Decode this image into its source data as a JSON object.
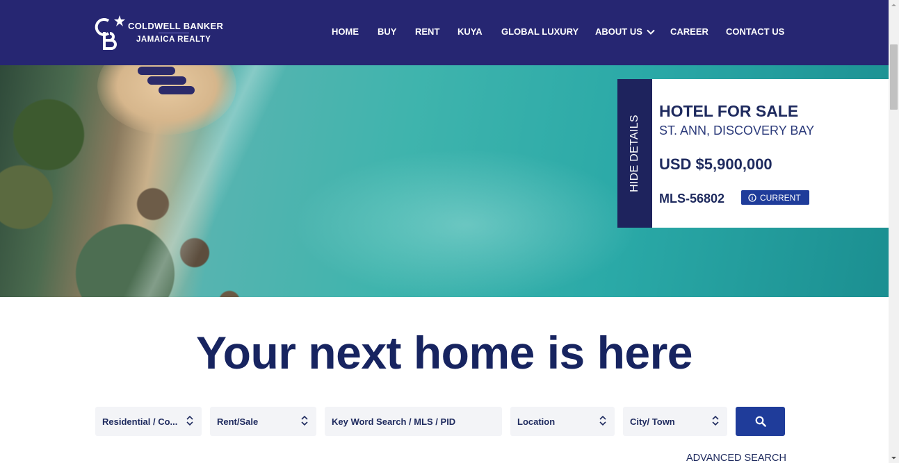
{
  "brand": {
    "line1": "COLDWELL BANKER",
    "line2": "JAMAICA REALTY",
    "logo_icon": "cb-star-logo-icon"
  },
  "nav": {
    "items": [
      {
        "label": "HOME"
      },
      {
        "label": "BUY"
      },
      {
        "label": "RENT"
      },
      {
        "label": "KUYA"
      },
      {
        "label": "GLOBAL LUXURY"
      },
      {
        "label": "ABOUT US",
        "icon": "chevron-down-icon"
      },
      {
        "label": "CAREER"
      },
      {
        "label": "CONTACT US"
      }
    ]
  },
  "hero": {
    "hide_tab_label": "HIDE DETAILS",
    "property": {
      "type": "HOTEL FOR SALE",
      "location": "ST. ANN, DISCOVERY BAY",
      "price": "USD $5,900,000",
      "mls": "MLS-56802",
      "status": "CURRENT",
      "status_icon": "info-circle-icon"
    }
  },
  "headline": "Your next home is here",
  "search": {
    "property_type": "Residential / Co...",
    "transaction": "Rent/Sale",
    "keyword_placeholder": "Key Word Search / MLS / PID",
    "location": "Location",
    "city": "City/ Town",
    "button_icon": "search-icon",
    "advanced_label": "ADVANCED SEARCH"
  },
  "colors": {
    "header_bg": "#262672",
    "headline": "#172460",
    "accent_button": "#1f3c9a",
    "tab_bg": "#1e235d"
  }
}
